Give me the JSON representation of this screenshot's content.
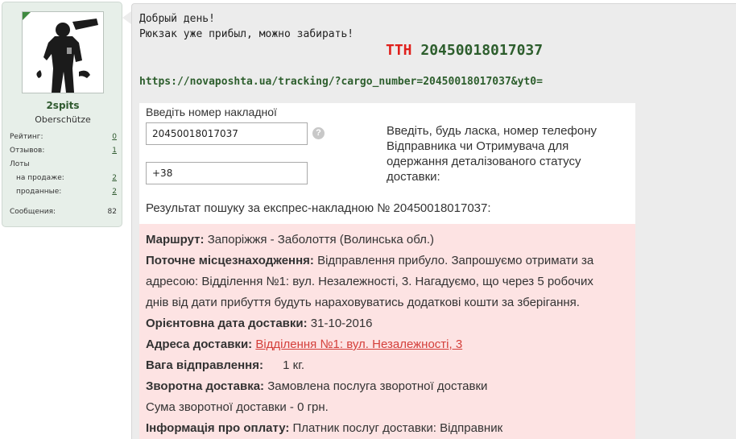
{
  "user": {
    "name": "2spits",
    "title": "Oberschütze",
    "stats": [
      {
        "label": "Рейтинг:",
        "value": "0",
        "link": true
      },
      {
        "label": "Отзывов:",
        "value": "1",
        "link": true
      },
      {
        "label": "Лоты",
        "value": "",
        "link": false
      },
      {
        "label": "на продаже:",
        "value": "2",
        "link": true
      },
      {
        "label": "проданные:",
        "value": "2",
        "link": true
      },
      {
        "label": "Сообщения:",
        "value": "82",
        "link": false
      }
    ]
  },
  "post": {
    "line1": "Добрый день!",
    "line2": "Рюкзак уже прибыл, можно забирать!",
    "ttn_prefix": "ТТН",
    "ttn_number": "20450018017037",
    "tracking_link": "https://novaposhta.ua/tracking/?cargo_number=20450018017037&yt0="
  },
  "tracker": {
    "invoice_label": "Введіть номер накладної",
    "invoice_value": "20450018017037",
    "phone_value": "+38",
    "help_icon": "?",
    "hint": "Введіть, будь ласка, номер телефону Відправника чи Отримувача для одержання деталізованого статусу доставки:",
    "result_title": "Результат пошуку за експрес-накладною № 20450018017037:",
    "route_label": "Маршрут:",
    "route_value": "Запоріжжя - Заболоття (Волинська обл.)",
    "location_label": "Поточне місцезнаходження:",
    "location_value_1": "Відправлення прибуло. Запрошуємо отримати за",
    "location_value_2": "адресою: Відділення №1: вул. Незалежності, 3. Нагадуємо, що через 5 робочих",
    "location_value_3": "днів від дати прибуття будуть нараховуватись додаткові кошти за зберігання.",
    "date_label": "Орієнтовна дата доставки:",
    "date_value": "31-10-2016",
    "address_label": "Адреса доставки:",
    "address_value": "Відділення №1: вул. Незалежності, 3",
    "weight_label": "Вага відправлення:",
    "weight_value": "1 кг.",
    "return_label": "Зворотна доставка:",
    "return_value": "Замовлена послуга зворотної доставки",
    "return_sum": "Сума зворотної доставки - 0 грн.",
    "payment_label": "Інформація про оплату:",
    "payment_value": "Платник послуг доставки: Відправник"
  },
  "colors": {
    "ttn_prefix": "#e0201c",
    "ttn_number": "#2d5e2d",
    "link": "#2d5e2d",
    "info_background": "#fde3e3",
    "address_link": "#d43f3a"
  }
}
